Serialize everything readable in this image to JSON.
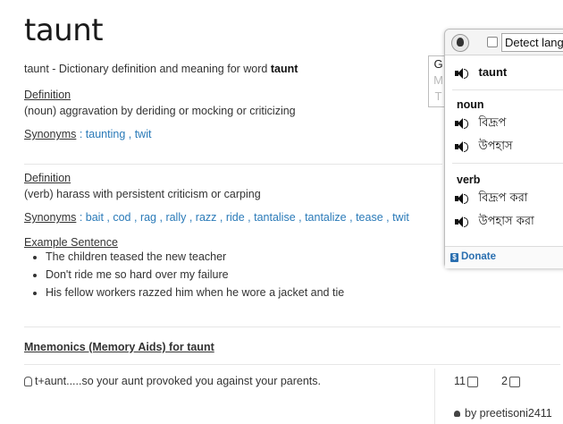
{
  "word": "taunt",
  "intro": {
    "prefix": "taunt - Dictionary definition and meaning for word ",
    "bold_word": "taunt"
  },
  "definitions": [
    {
      "heading": "Definition",
      "text": "(noun) aggravation by deriding or mocking or criticizing",
      "synonyms_label": "Synonyms",
      "synonyms": [
        "taunting",
        "twit"
      ]
    },
    {
      "heading": "Definition",
      "text": "(verb) harass with persistent criticism or carping",
      "synonyms_label": "Synonyms",
      "synonyms": [
        "bait",
        "cod",
        "rag",
        "rally",
        "razz",
        "ride",
        "tantalise",
        "tantalize",
        "tease",
        "twit"
      ]
    }
  ],
  "example": {
    "heading": "Example Sentence",
    "sentences": [
      "The children teased the new teacher",
      "Don't ride me so hard over my failure",
      "His fellow workers razzed him when he wore a jacket and tie"
    ]
  },
  "mnemonics": {
    "title": "Mnemonics (Memory Aids) for taunt",
    "entry_text": "t+aunt.....so your aunt provoked you against your parents.",
    "upvotes": "11",
    "downvotes": "2",
    "author": "by preetisoni2411"
  },
  "popup": {
    "detect_label": "Detect lang",
    "gmt_letters": [
      "G",
      "M",
      "T"
    ],
    "headword": "taunt",
    "sections": [
      {
        "pos": "noun",
        "terms": [
          "বিদ্রূপ",
          "উপহাস"
        ]
      },
      {
        "pos": "verb",
        "terms": [
          "বিদ্রূপ করা",
          "উপহাস করা"
        ]
      }
    ],
    "donate_label": "Donate"
  },
  "colors": {
    "link": "#2a7ab8",
    "donate": "#2a6fb0"
  }
}
